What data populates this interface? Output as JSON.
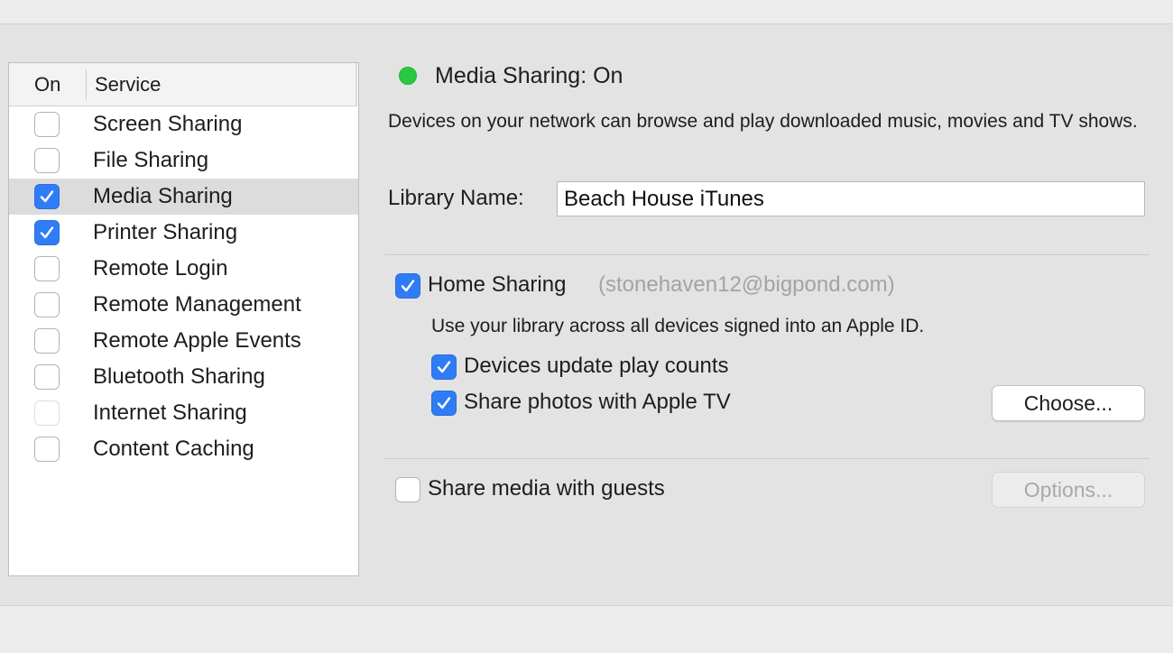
{
  "list": {
    "header_on": "On",
    "header_service": "Service",
    "items": [
      {
        "label": "Screen Sharing",
        "checked": false
      },
      {
        "label": "File Sharing",
        "checked": false
      },
      {
        "label": "Media Sharing",
        "checked": true,
        "selected": true
      },
      {
        "label": "Printer Sharing",
        "checked": true
      },
      {
        "label": "Remote Login",
        "checked": false
      },
      {
        "label": "Remote Management",
        "checked": false
      },
      {
        "label": "Remote Apple Events",
        "checked": false
      },
      {
        "label": "Bluetooth Sharing",
        "checked": false
      },
      {
        "label": "Internet Sharing",
        "checked": false,
        "disabled": true
      },
      {
        "label": "Content Caching",
        "checked": false
      }
    ]
  },
  "detail": {
    "status_title": "Media Sharing: On",
    "status_color": "#2ac840",
    "description": "Devices on your network can browse and play downloaded music, movies and TV shows.",
    "library_label": "Library Name:",
    "library_value": "Beach House iTunes",
    "home_sharing": {
      "label": "Home Sharing",
      "checked": true,
      "account": "(stonehaven12@bigpond.com)",
      "description": "Use your library across all devices signed into an Apple ID.",
      "options": [
        {
          "label": "Devices update play counts",
          "checked": true
        },
        {
          "label": "Share photos with Apple TV",
          "checked": true
        }
      ],
      "choose_button": "Choose..."
    },
    "guests": {
      "label": "Share media with guests",
      "checked": false,
      "options_button": "Options..."
    }
  },
  "accent_color": "#2f7cf6"
}
